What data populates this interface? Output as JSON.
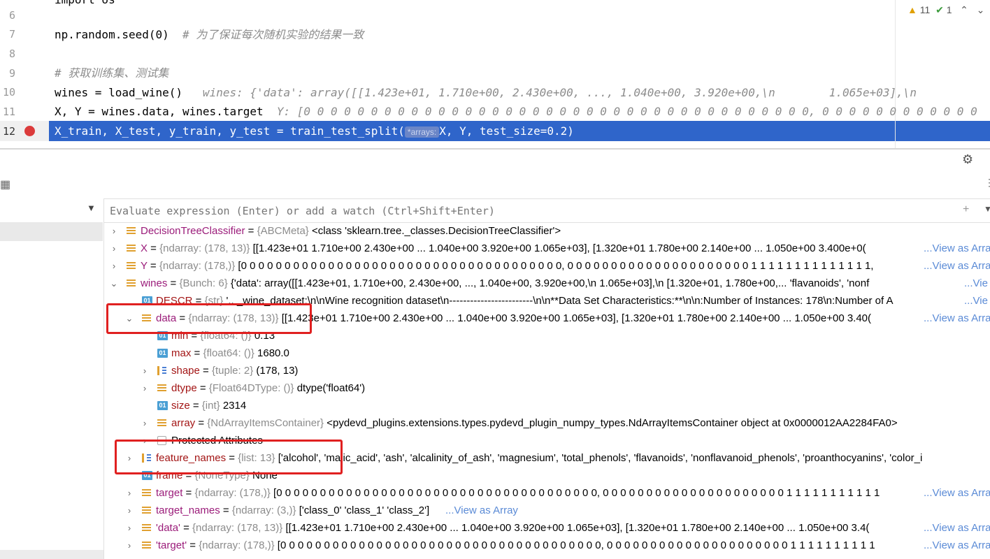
{
  "editor": {
    "lines": [
      {
        "num": "6",
        "code": "",
        "hint": ""
      },
      {
        "num": "7",
        "code": "np.random.seed(0)  ",
        "comment": "# 为了保证每次随机实验的结果一致"
      },
      {
        "num": "8",
        "code": ""
      },
      {
        "num": "9",
        "code": "",
        "comment": "# 获取训练集、测试集"
      },
      {
        "num": "10",
        "code": "wines = load_wine()",
        "hint": "   wines: {'data': array([[1.423e+01, 1.710e+00, 2.430e+00, ..., 1.040e+00, 3.920e+00,\\n        1.065e+03],\\n"
      },
      {
        "num": "11",
        "code": "X, Y = wines.data, wines.target",
        "hint": "  Y: [0 0 0 0 0 0 0 0 0 0 0 0 0 0 0 0 0 0 0 0 0 0 0 0 0 0 0 0 0 0 0 0 0 0 0 0 0 0, 0 0 0 0 0 0 0 0 0 0 0 0"
      },
      {
        "num": "12",
        "code_pre": "X_train, X_test, y_train, y_test = train_test_split(",
        "tag": "*arrays:",
        "code_post": "X, Y, test_size=0.2)"
      }
    ],
    "top_partial": "import os",
    "inspections": {
      "warnings": "11",
      "ok": "1"
    }
  },
  "debugger": {
    "eval_placeholder": "Evaluate expression (Enter) or add a watch (Ctrl+Shift+Enter)",
    "view_as_array": "...View as Array",
    "view_short": "...Vie",
    "rows": [
      {
        "name": "DecisionTreeClassifier",
        "type": "{ABCMeta}",
        "value": "<class 'sklearn.tree._classes.DecisionTreeClassifier'>"
      },
      {
        "name": "X",
        "type": "{ndarray: (178, 13)}",
        "value": "[[1.423e+01 1.710e+00 2.430e+00 ... 1.040e+00 3.920e+00 1.065e+03], [1.320e+01 1.780e+00 2.140e+00 ... 1.050e+00 3.400e+0("
      },
      {
        "name": "Y",
        "type": "{ndarray: (178,)}",
        "value": "[0 0 0 0 0 0 0 0 0 0 0 0 0 0 0 0 0 0 0 0 0 0 0 0 0 0 0 0 0 0 0 0 0 0 0 0 0, 0 0 0 0 0 0 0 0 0 0 0 0 0 0 0 0 0 0 0 0 0 1 1 1 1 1 1 1 1 1 1 1 1 1 1,"
      },
      {
        "name": "wines",
        "type": "{Bunch: 6}",
        "value": "{'data': array([[1.423e+01, 1.710e+00, 2.430e+00, ..., 1.040e+00, 3.920e+00,\\n        1.065e+03],\\n        [1.320e+01, 1.780e+00,... 'flavanoids', 'nonf"
      },
      {
        "name": "DESCR",
        "type": "{str}",
        "value": "'.. _wine_dataset:\\n\\nWine recognition dataset\\n------------------------\\n\\n**Data Set Characteristics:**\\n\\n:Number of Instances: 178\\n:Number of A"
      },
      {
        "name": "data",
        "type": "{ndarray: (178, 13)}",
        "value": "[[1.423e+01 1.710e+00 2.430e+00 ... 1.040e+00 3.920e+00 1.065e+03], [1.320e+01 1.780e+00 2.140e+00 ... 1.050e+00 3.40("
      },
      {
        "name": "min",
        "type": "{float64: ()}",
        "value": "0.13"
      },
      {
        "name": "max",
        "type": "{float64: ()}",
        "value": "1680.0"
      },
      {
        "name": "shape",
        "type": "{tuple: 2}",
        "value": "(178, 13)"
      },
      {
        "name": "dtype",
        "type": "{Float64DType: ()}",
        "value": "dtype('float64')"
      },
      {
        "name": "size",
        "type": "{int}",
        "value": "2314"
      },
      {
        "name": "array",
        "type": "{NdArrayItemsContainer}",
        "value": "<pydevd_plugins.extensions.types.pydevd_plugin_numpy_types.NdArrayItemsContainer object at 0x0000012AA2284FA0>"
      },
      {
        "name": "Protected Attributes",
        "type": "",
        "value": ""
      },
      {
        "name": "feature_names",
        "type": "{list: 13}",
        "value": "['alcohol', 'malic_acid', 'ash', 'alcalinity_of_ash', 'magnesium', 'total_phenols', 'flavanoids', 'nonflavanoid_phenols', 'proanthocyanins', 'color_i"
      },
      {
        "name": "frame",
        "type": "{NoneType}",
        "value": "None"
      },
      {
        "name": "target",
        "type": "{ndarray: (178,)}",
        "value": "[0 0 0 0 0 0 0 0 0 0 0 0 0 0 0 0 0 0 0 0 0 0 0 0 0 0 0 0 0 0 0 0 0 0 0 0 0, 0 0 0 0 0 0 0 0 0 0 0 0 0 0 0 0 0 0 0 0 0 1 1 1 1 1 1 1 1 1 1 1"
      },
      {
        "name": "target_names",
        "type": "{ndarray: (3,)}",
        "value": "['class_0' 'class_1' 'class_2']"
      },
      {
        "name": "'data'",
        "type": "{ndarray: (178, 13)}",
        "value": "[[1.423e+01 1.710e+00 2.430e+00 ... 1.040e+00 3.920e+00 1.065e+03], [1.320e+01 1.780e+00 2.140e+00 ... 1.050e+00 3.4("
      },
      {
        "name": "'target'",
        "type": "{ndarray: (178,)}",
        "value": "[0 0 0 0 0 0 0 0 0 0 0 0 0 0 0 0 0 0 0 0 0 0 0 0 0 0 0 0 0 0 0 0 0 0 0 0 0, 0 0 0 0 0 0 0 0 0 0 0 0 0 0 0 0 0 0 0 0 0 1 1 1 1 1 1 1 1 1 1"
      }
    ]
  },
  "icons": {
    "gear": "gear-icon",
    "add_watch": "add-watch-icon",
    "breakpoint": "breakpoint-icon"
  },
  "colors": {
    "selection": "#2f65ca",
    "breakpoint": "#db3b3b",
    "highlight_box": "#e02020",
    "link": "#5b8bd6"
  }
}
